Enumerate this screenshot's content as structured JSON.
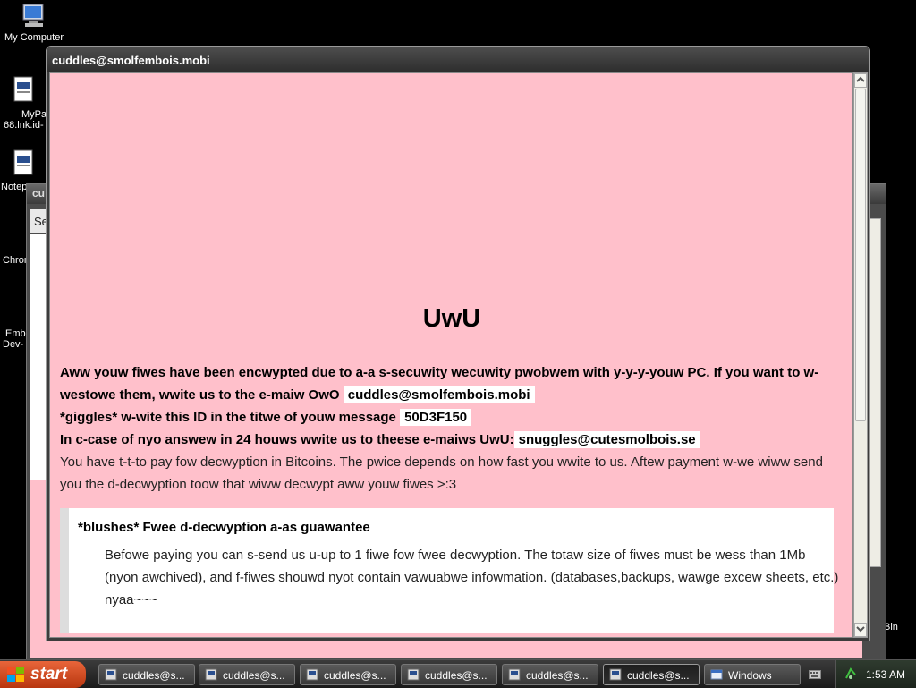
{
  "desktop": {
    "icons": [
      {
        "label": "My Computer"
      },
      {
        "label_line1": "MyPa",
        "label_line2": "68.lnk.id-"
      },
      {
        "label": "Notep"
      },
      {
        "label": "Chrom"
      },
      {
        "label_line1": "Emb",
        "label_line2": "Dev-"
      }
    ],
    "recycle_partial": "Bin"
  },
  "background_windows": {
    "title_fragment": "cu",
    "tab_fragment": "Se"
  },
  "window": {
    "title": "cuddles@smolfembois.mobi"
  },
  "note": {
    "heading": "UwU",
    "line1": "Aww youw fiwes have been encwypted due to a-a s-secuwity wecuwity pwobwem with y-y-y-youw PC. If you want to w-westowe them, wwite us to the e-maiw OwO",
    "email1": "cuddles@smolfembois.mobi",
    "line2": "*giggles* w-wite this ID in the titwe of youw message",
    "id": "50D3F150",
    "line3": "In c-case of nyo answew in 24 houws wwite us to theese e-maiws UwU:",
    "email2": "snuggles@cutesmolbois.se",
    "line4": "You have t-t-to pay fow decwyption in Bitcoins. The pwice depends on how fast you wwite to us. Aftew payment w-we wiww send you the d-decwyption toow that wiww decwypt aww youw fiwes >:3",
    "guarantee_title": "*blushes* Fwee d-decwyption a-as guawantee",
    "guarantee_body": "Befowe paying you can s-send us u-up to 1 fiwe fow fwee decwyption. The totaw size of fiwes must be wess than 1Mb (nyon awchived), and f-fiwes shouwd nyot contain vawuabwe infowmation. (databases,backups, wawge excew sheets, etc.) nyaa~~~"
  },
  "taskbar": {
    "start_label": "start",
    "tasks": [
      "cuddles@s...",
      "cuddles@s...",
      "cuddles@s...",
      "cuddles@s...",
      "cuddles@s...",
      "cuddles@s...",
      "Windows"
    ],
    "clock": "1:53 AM"
  }
}
